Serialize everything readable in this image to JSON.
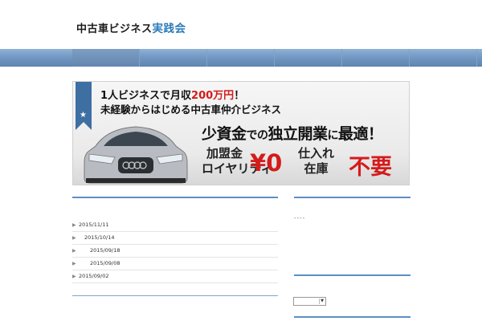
{
  "site": {
    "title_part1": "中古車ビジネス",
    "title_part2": "実践会"
  },
  "nav": {
    "items": [
      "",
      "",
      "",
      "",
      "",
      "",
      ""
    ]
  },
  "banner": {
    "line1_prefix": "1人ビジネスで月収",
    "line1_highlight": "200万円",
    "line1_suffix": "！",
    "line2": "未経験からはじめる中古車仲介ビジネス",
    "headline_part1": "少資金",
    "headline_small1": "での",
    "headline_part2": "独立開業",
    "headline_small2": "に",
    "headline_part3": "最適！",
    "fee_label1": "加盟金",
    "fee_label2": "ロイヤリティ",
    "fee_value": "¥0",
    "stock_label1": "仕入れ",
    "stock_label2": "在庫",
    "stock_value": "不要"
  },
  "archive": {
    "items": [
      {
        "date": "2015/11/11",
        "indent": 0
      },
      {
        "date": "2015/10/14",
        "indent": 1
      },
      {
        "date": "2015/09/18",
        "indent": 2
      },
      {
        "date": "2015/09/08",
        "indent": 2
      },
      {
        "date": "2015/09/02",
        "indent": 0
      }
    ]
  },
  "sidebar": {
    "dashes": "----",
    "select_value": ""
  },
  "colors": {
    "accent": "#2a7ab8",
    "nav": "#6f95c0",
    "banner_red": "#d41b1b",
    "section_line": "#5d8ec3"
  }
}
